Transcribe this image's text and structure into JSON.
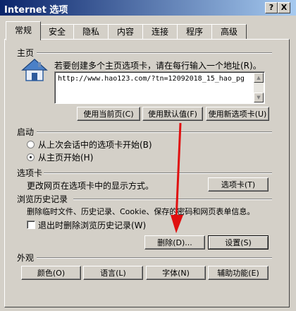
{
  "window": {
    "title": "Internet 选项",
    "help_label": "?",
    "close_label": "X"
  },
  "tabs": [
    "常规",
    "安全",
    "隐私",
    "内容",
    "连接",
    "程序",
    "高级"
  ],
  "home": {
    "group_label": "主页",
    "instruction": "若要创建多个主页选项卡，请在每行输入一个地址(R)。",
    "url": "http://www.hao123.com/?tn=12092018_15_hao_pg",
    "buttons": [
      "使用当前页(C)",
      "使用默认值(F)",
      "使用新选项卡(U)"
    ]
  },
  "startup": {
    "group_label": "启动",
    "options": [
      "从上次会话中的选项卡开始(B)",
      "从主页开始(H)"
    ],
    "selected_index": 1
  },
  "tabs_section": {
    "group_label": "选项卡",
    "description": "更改网页在选项卡中的显示方式。",
    "button": "选项卡(T)"
  },
  "history": {
    "group_label": "浏览历史记录",
    "description": "删除临时文件、历史记录、Cookie、保存的密码和网页表单信息。",
    "checkbox_label": "退出时删除浏览历史记录(W)",
    "checkbox_checked": false,
    "delete_button": "删除(D)...",
    "settings_button": "设置(S)"
  },
  "appearance": {
    "group_label": "外观",
    "buttons": [
      "颜色(O)",
      "语言(L)",
      "字体(N)",
      "辅助功能(E)"
    ]
  },
  "colors": {
    "annotation_arrow": "#e01010"
  }
}
